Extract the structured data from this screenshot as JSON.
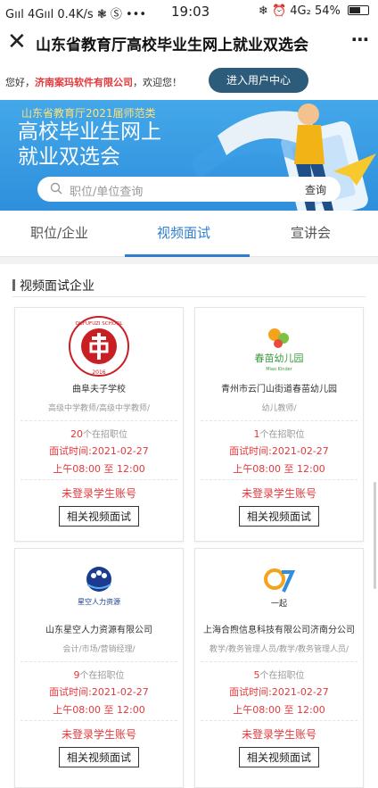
{
  "status": {
    "left": "Gııl 4Gııl 0.4K/s ❃ Ⓢ •••",
    "time": "19:03",
    "right": "❄ ⏰ 4G₂ 54%",
    "battery_level": 0.54
  },
  "titlebar": {
    "title": "山东省教育厅高校毕业生网上就业双选会"
  },
  "welcome": {
    "prefix": "您好，",
    "company": "济南案玛软件有限公司",
    "suffix": "，欢迎您！"
  },
  "usercenter_label": "进入用户中心",
  "banner": {
    "subtitle": "山东省教育厅2021届师范类",
    "title_line1": "高校毕业生网上",
    "title_line2": "就业双选会"
  },
  "search": {
    "placeholder": "职位/单位查询",
    "button": "查询"
  },
  "tabs": [
    "职位/企业",
    "视频面试",
    "宣讲会"
  ],
  "section_title": "视频面试企业",
  "cards": [
    {
      "name": "曲阜夫子学校",
      "jobs": "高级中学教师/高级中学教师/",
      "count": "20",
      "count_suffix": "个在招职位",
      "time": "面试时间:2021-02-27",
      "slot": "上午08:00 至 12:00",
      "login": "未登录学生账号",
      "button": "相关视频面试",
      "logo_text": "QUFUFUZI SCHOOL",
      "logo_year": "2016"
    },
    {
      "name": "青州市云门山街道春苗幼儿园",
      "jobs": "幼儿教师/",
      "count": "1",
      "count_suffix": "个在招职位",
      "time": "面试时间:2021-02-27",
      "slot": "上午08:00 至 12:00",
      "login": "未登录学生账号",
      "button": "相关视频面试",
      "logo_text": "春苗幼儿园",
      "logo_sub": "Miao Kinder"
    },
    {
      "name": "山东星空人力资源有限公司",
      "jobs": "会计/市场/营销经理/",
      "count": "9",
      "count_suffix": "个在招职位",
      "time": "面试时间:2021-02-27",
      "slot": "上午08:00 至 12:00",
      "login": "未登录学生账号",
      "button": "相关视频面试",
      "logo_text": "星空人力资源"
    },
    {
      "name": "上海合煦信息科技有限公司济南分公司",
      "jobs": "教学/教务管理人员/教学/教务管理人员/",
      "count": "5",
      "count_suffix": "个在招职位",
      "time": "面试时间:2021-02-27",
      "slot": "上午08:00 至 12:00",
      "login": "未登录学生账号",
      "button": "相关视频面试",
      "logo_text": "一起"
    }
  ]
}
